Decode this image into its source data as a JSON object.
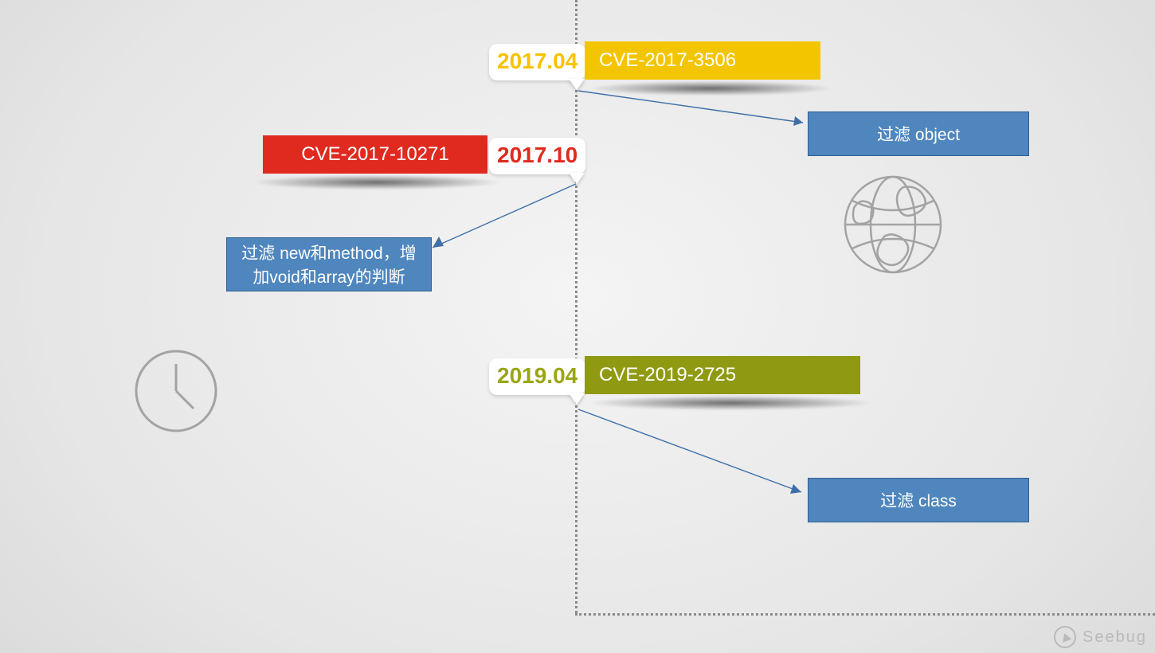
{
  "colors": {
    "yellow": "#f3c500",
    "red": "#e02a1f",
    "olive": "#8f9a12",
    "blue": "#4f86be"
  },
  "timeline": {
    "2017_04": {
      "date": "2017.04",
      "cve": "CVE-2017-3506"
    },
    "2017_10": {
      "date": "2017.10",
      "cve": "CVE-2017-10271"
    },
    "2019_04": {
      "date": "2019.04",
      "cve": "CVE-2019-2725"
    }
  },
  "notes": {
    "filter_object": "过滤 object",
    "filter_new_method": "过滤 new和method，增加void和array的判断",
    "filter_class": "过滤 class"
  },
  "watermark": "Seebug"
}
